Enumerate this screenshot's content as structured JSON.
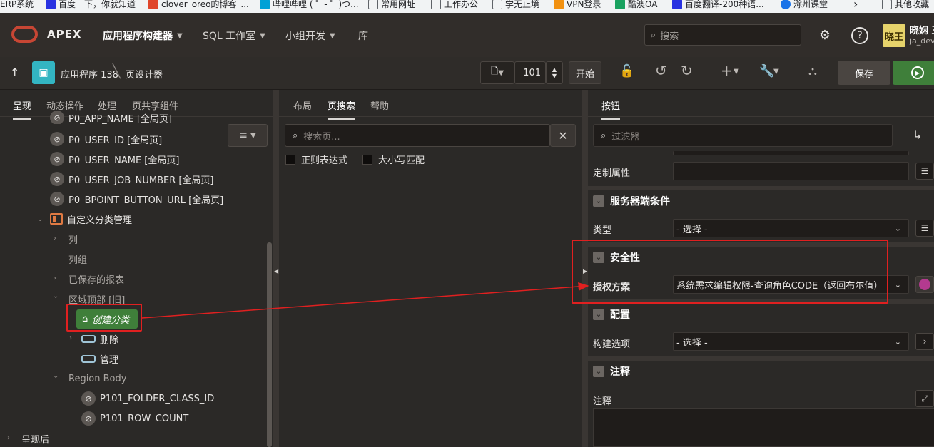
{
  "bookmarks": [
    {
      "label": "ERP系统",
      "color": "#1a73e8"
    },
    {
      "label": "百度一下，你就知道",
      "color": "#2932e1"
    },
    {
      "label": "clover_oreo的博客_...",
      "color": "#e0452a"
    },
    {
      "label": "哔哩哔哩 ( ゜- ゜)つ...",
      "color": "#00a1d6"
    },
    {
      "label": "常用网址",
      "color": "#5f6368"
    },
    {
      "label": "工作办公",
      "color": "#5f6368"
    },
    {
      "label": "学无止境",
      "color": "#5f6368"
    },
    {
      "label": "VPN登录",
      "color": "#f29111"
    },
    {
      "label": "酷澳OA",
      "color": "#1aa260"
    },
    {
      "label": "百度翻译-200种语...",
      "color": "#2932e1"
    },
    {
      "label": "滁州课堂",
      "color": "#1a73e8"
    },
    {
      "label": "其他收藏",
      "color": "#5f6368"
    }
  ],
  "header": {
    "logo": "APEX",
    "nav": [
      {
        "label": "应用程序构建器"
      },
      {
        "label": "SQL 工作室"
      },
      {
        "label": "小组开发"
      },
      {
        "label": "库"
      }
    ],
    "search_placeholder": "搜索",
    "avatar_text": "晓王",
    "user_name": "晓娴 王",
    "user_id": "ja_dev"
  },
  "toolbar": {
    "app_crumb": "应用程序 138",
    "page_crumb": "页设计器",
    "page_number": "101",
    "start_label": "开始",
    "save_label": "保存"
  },
  "left_panel": {
    "tabs": [
      "呈现",
      "动态操作",
      "处理",
      "页共享组件"
    ],
    "items": {
      "app_name": "P0_APP_NAME [全局页]",
      "user_id": "P0_USER_ID [全局页]",
      "user_name": "P0_USER_NAME [全局页]",
      "job_number": "P0_USER_JOB_NUMBER [全局页]",
      "bpoint": "P0_BPOINT_BUTTON_URL [全局页]",
      "region": "自定义分类管理",
      "columns": "列",
      "col_groups": "列组",
      "saved_reports": "已保存的报表",
      "region_top": "区域顶部 [旧]",
      "create_btn": "创建分类",
      "delete": "删除",
      "manage": "管理",
      "region_body": "Region Body",
      "folder_class": "P101_FOLDER_CLASS_ID",
      "row_count": "P101_ROW_COUNT",
      "after": "呈现后"
    }
  },
  "mid_panel": {
    "tabs": [
      "布局",
      "页搜索",
      "帮助"
    ],
    "search_placeholder": "搜索页...",
    "regex_label": "正则表达式",
    "case_label": "大小写匹配"
  },
  "right_panel": {
    "tab": "按钮",
    "filter_placeholder": "过滤器",
    "custom_attr_label": "定制属性",
    "server_cond": "服务器端条件",
    "type_label": "类型",
    "type_value": "- 选择 -",
    "security": "安全性",
    "auth_label": "授权方案",
    "auth_value": "系统需求编辑权限-查询角色CODE（返回布尔值）",
    "config": "配置",
    "build_label": "构建选项",
    "build_value": "- 选择 -",
    "comments": "注释",
    "comments_label": "注释"
  },
  "colors": {
    "accent_red": "#e02020",
    "oracle_red": "#c74634",
    "run_green": "#3f7f3a",
    "app_icon": "#33b5c2"
  }
}
